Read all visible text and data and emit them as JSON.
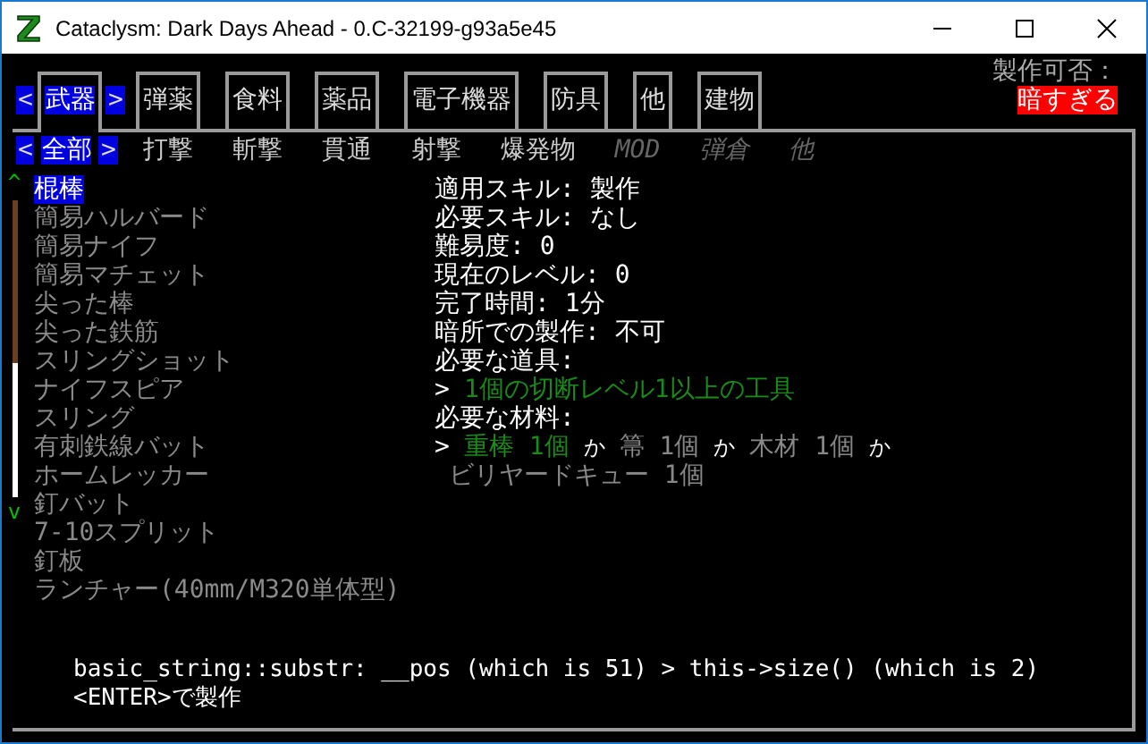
{
  "window": {
    "title": "Cataclysm: Dark Days Ahead - 0.C-32199-g93a5e45"
  },
  "category_nav": {
    "prev": "<",
    "next": ">"
  },
  "categories": [
    {
      "label": "武器",
      "selected": true
    },
    {
      "label": "弾薬",
      "selected": false
    },
    {
      "label": "食料",
      "selected": false
    },
    {
      "label": "薬品",
      "selected": false
    },
    {
      "label": "電子機器",
      "selected": false
    },
    {
      "label": "防具",
      "selected": false
    },
    {
      "label": "他",
      "selected": false
    },
    {
      "label": "建物",
      "selected": false
    }
  ],
  "craftability": {
    "label": "製作可否：",
    "status": "暗すぎる"
  },
  "subcategory_nav": {
    "prev": "<",
    "next": ">"
  },
  "subcategories": [
    {
      "label": "全部",
      "selected": true,
      "disabled": false
    },
    {
      "label": "打撃",
      "selected": false,
      "disabled": false
    },
    {
      "label": "斬撃",
      "selected": false,
      "disabled": false
    },
    {
      "label": "貫通",
      "selected": false,
      "disabled": false
    },
    {
      "label": "射撃",
      "selected": false,
      "disabled": false
    },
    {
      "label": "爆発物",
      "selected": false,
      "disabled": false
    },
    {
      "label": "MOD",
      "selected": false,
      "disabled": true
    },
    {
      "label": "弾倉",
      "selected": false,
      "disabled": true
    },
    {
      "label": "他",
      "selected": false,
      "disabled": true
    }
  ],
  "scroll": {
    "up": "^",
    "down": "v"
  },
  "recipes": [
    {
      "name": "棍棒",
      "selected": true
    },
    {
      "name": "簡易ハルバード",
      "selected": false
    },
    {
      "name": "簡易ナイフ",
      "selected": false
    },
    {
      "name": "簡易マチェット",
      "selected": false
    },
    {
      "name": "尖った棒",
      "selected": false
    },
    {
      "name": "尖った鉄筋",
      "selected": false
    },
    {
      "name": "スリングショット",
      "selected": false
    },
    {
      "name": "ナイフスピア",
      "selected": false
    },
    {
      "name": "スリング",
      "selected": false
    },
    {
      "name": "有刺鉄線バット",
      "selected": false
    },
    {
      "name": "ホームレッカー",
      "selected": false
    },
    {
      "name": "釘バット",
      "selected": false
    },
    {
      "name": "7-10スプリット",
      "selected": false
    },
    {
      "name": "釘板",
      "selected": false
    },
    {
      "name": "ランチャー(40mm/M320単体型)",
      "selected": false
    }
  ],
  "details": [
    "適用スキル: 製作",
    "必要スキル: なし",
    "難易度: 0",
    "現在のレベル: 0",
    "完了時間: 1分",
    "暗所での製作: 不可",
    "必要な道具:"
  ],
  "tools": {
    "marker": ">",
    "items": [
      {
        "text": "1個の切断レベル1以上の工具",
        "available": true
      }
    ]
  },
  "materials_label": "必要な材料:",
  "materials": {
    "marker": ">",
    "items": [
      {
        "kind": "component",
        "text": "重棒 1個",
        "available": true
      },
      {
        "kind": "separator",
        "text": "か"
      },
      {
        "kind": "component",
        "text": "箒 1個",
        "available": false
      },
      {
        "kind": "separator",
        "text": "か"
      },
      {
        "kind": "component",
        "text": "木材 1個",
        "available": false
      },
      {
        "kind": "separator",
        "text": "か"
      },
      {
        "kind": "component",
        "text": "ビリヤードキュー 1個",
        "available": false
      }
    ]
  },
  "messages": [
    "basic_string::substr: __pos (which is 51) > this->size() (which is 2)",
    "<ENTER>で製作"
  ]
}
